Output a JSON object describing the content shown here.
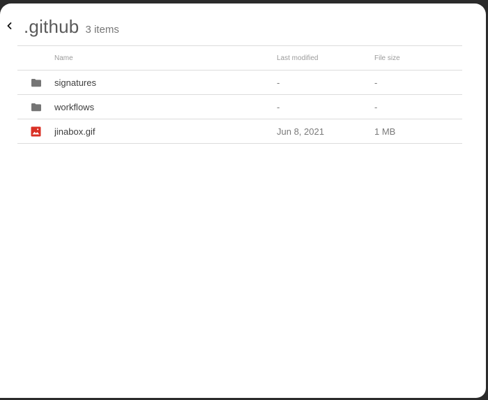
{
  "header": {
    "title": ".github",
    "item_count": "3 items"
  },
  "table": {
    "columns": [
      "Name",
      "Last modified",
      "File size"
    ],
    "rows": [
      {
        "icon": "folder-icon",
        "name": "signatures",
        "last_modified": "-",
        "file_size": "-"
      },
      {
        "icon": "folder-icon",
        "name": "workflows",
        "last_modified": "-",
        "file_size": "-"
      },
      {
        "icon": "image-file-icon",
        "name": "jinabox.gif",
        "last_modified": "Jun 8, 2021",
        "file_size": "1 MB"
      }
    ]
  },
  "colors": {
    "folder_icon": "#757575",
    "image_icon": "#d93025",
    "title": "#5a5a5a"
  },
  "icons": {
    "back": "chevron-left-icon"
  }
}
